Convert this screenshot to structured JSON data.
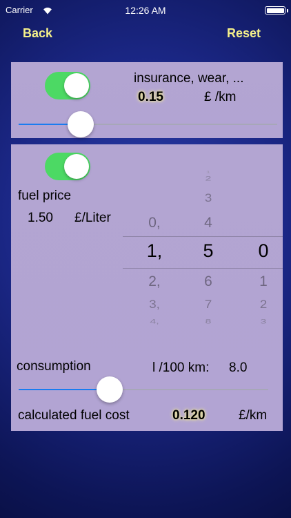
{
  "status_bar": {
    "carrier": "Carrier",
    "wifi_icon": "wifi-icon",
    "time": "12:26 AM",
    "battery_icon": "battery-icon"
  },
  "nav": {
    "back_label": "Back",
    "reset_label": "Reset"
  },
  "other_costs": {
    "toggle_on": true,
    "label": "insurance, wear, ...",
    "value": "0.15",
    "unit": "£ /km",
    "slider_fraction": 0.21
  },
  "fuel": {
    "toggle_on": true,
    "price_label": "fuel price",
    "price_value": "1.50",
    "price_unit": "£/Liter",
    "picker": {
      "col1": {
        "selected": "1,",
        "above": [
          "0,"
        ],
        "below": [
          "2,",
          "3,",
          "4,"
        ]
      },
      "col2": {
        "selected": "5",
        "above": [
          "4",
          "3",
          "2",
          "1"
        ],
        "below": [
          "6",
          "7",
          "8"
        ]
      },
      "col3": {
        "selected": "0",
        "above": [],
        "below": [
          "1",
          "2",
          "3"
        ]
      }
    },
    "consumption_label": "consumption",
    "consumption_unit_label": "l /100 km:",
    "consumption_value": "8.0",
    "consumption_slider_fraction": 0.35,
    "cost_label": "calculated fuel cost",
    "cost_value": "0.120",
    "cost_unit": "£/km"
  },
  "colors": {
    "accent": "#f5f08a",
    "toggle_on": "#4cd964",
    "slider_fill": "#1a7cf0",
    "panel": "#b2a4d3",
    "background": "#1b2786"
  }
}
